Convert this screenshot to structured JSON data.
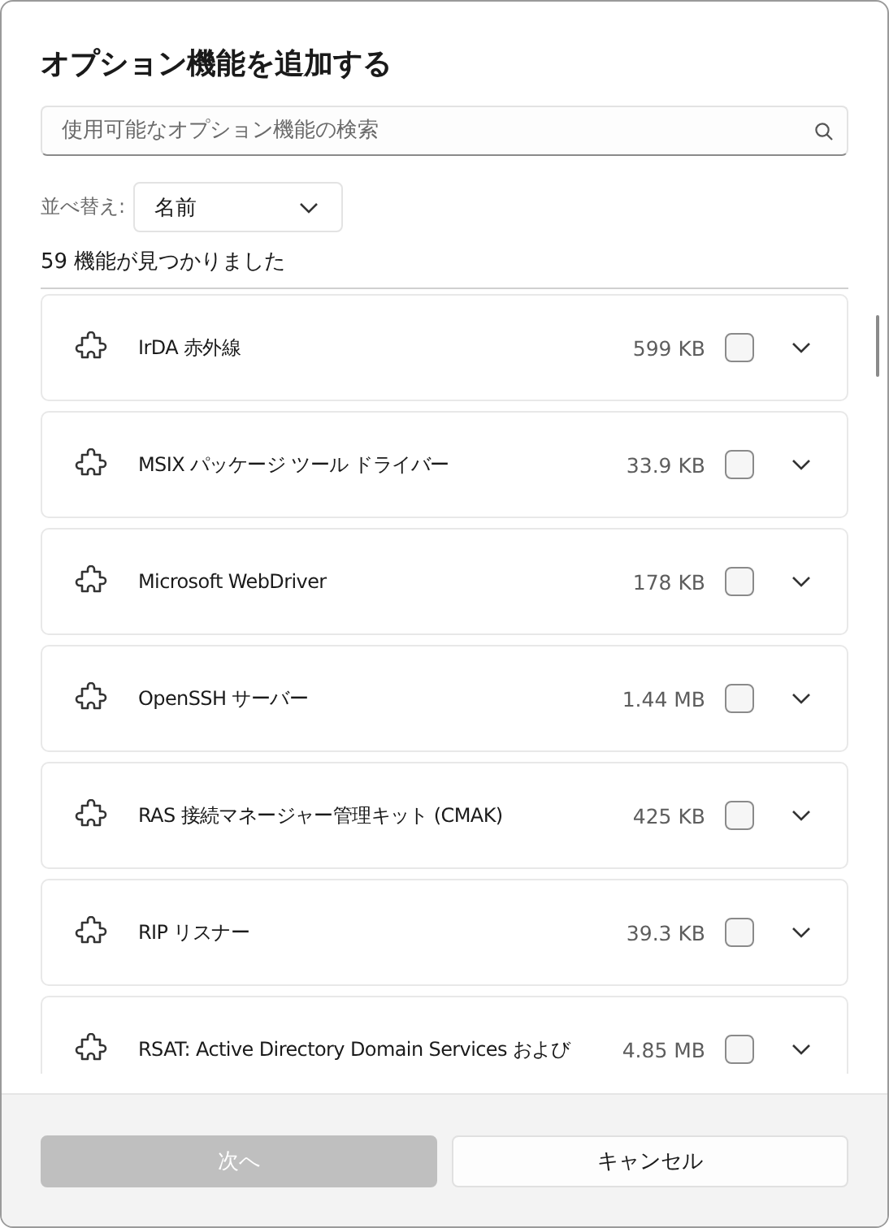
{
  "dialog": {
    "title": "オプション機能を追加する"
  },
  "search": {
    "placeholder": "使用可能なオプション機能の検索"
  },
  "sort": {
    "label": "並べ替え:",
    "value": "名前"
  },
  "result_count": "59 機能が見つかりました",
  "features": [
    {
      "name": "IrDA 赤外線",
      "size": "599 KB",
      "checked": false
    },
    {
      "name": "MSIX パッケージ ツール ドライバー",
      "size": "33.9 KB",
      "checked": false
    },
    {
      "name": "Microsoft WebDriver",
      "size": "178 KB",
      "checked": false
    },
    {
      "name": "OpenSSH サーバー",
      "size": "1.44 MB",
      "checked": false
    },
    {
      "name": "RAS 接続マネージャー管理キット (CMAK)",
      "size": "425 KB",
      "checked": false
    },
    {
      "name": "RIP リスナー",
      "size": "39.3 KB",
      "checked": false
    },
    {
      "name": "RSAT: Active Directory Domain Services および",
      "size": "4.85 MB",
      "checked": false
    }
  ],
  "buttons": [
    {
      "label": "次へ",
      "kind": "primary",
      "disabled": true
    },
    {
      "label": "キャンセル",
      "kind": "secondary",
      "disabled": false
    }
  ]
}
